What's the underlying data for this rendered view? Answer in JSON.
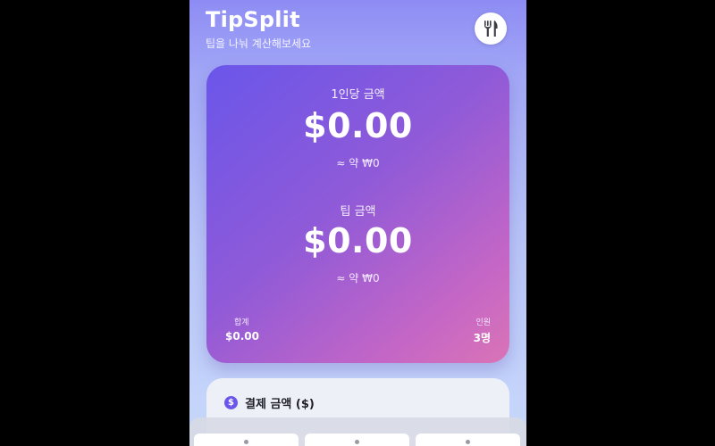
{
  "app": {
    "title": "TipSplit",
    "subtitle": "팁을 나눠 계산해보세요",
    "header_icon": "utensils-icon"
  },
  "summary": {
    "per_person_label": "1인당 금액",
    "per_person_amount": "$0.00",
    "per_person_krw": "≈ 약 ₩0",
    "tip_label": "팁 금액",
    "tip_amount": "$0.00",
    "tip_krw": "≈ 약 ₩0",
    "total_label": "합계",
    "total_value": "$0.00",
    "people_label": "인원",
    "people_value": "3명"
  },
  "payment": {
    "badge_symbol": "$",
    "title": "결제 금액 ($)"
  },
  "colors": {
    "accent": "#6a56ea",
    "card_gradient_start": "#6a56ea",
    "card_gradient_end": "#da74b6",
    "page_background": "#000000"
  }
}
